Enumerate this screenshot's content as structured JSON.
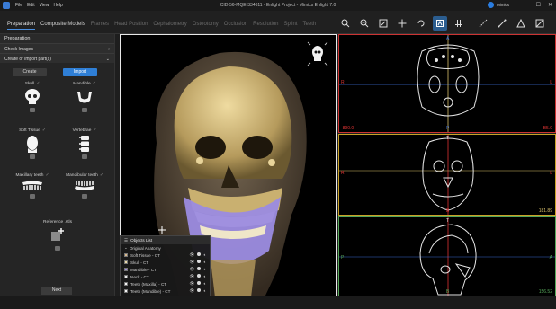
{
  "titlebar": {
    "menu": [
      "File",
      "Edit",
      "View",
      "Help"
    ],
    "title": "CID-56-MQE-334611 - Enlight Project - Mimics Enlight 7.0",
    "user": "Mimics",
    "controls": [
      "—",
      "☐",
      "✕"
    ]
  },
  "tabs": [
    "Preparation",
    "Composite Models",
    "Frames",
    "Head Position",
    "Cephalometry",
    "Osteotomy",
    "Occlusion",
    "Resolution",
    "Splint",
    "Teeth"
  ],
  "tools": [
    "zoom-in-icon",
    "zoom-fit-icon",
    "window-icon",
    "pan-icon",
    "rotate-icon",
    "view-3d-icon",
    "grid-icon",
    "measure-icon",
    "ruler-icon",
    "angle-icon",
    "frame-icon",
    "paint-icon"
  ],
  "panel": {
    "title": "Preparation",
    "check_images": "Check Images",
    "create_import": "Create or import part(s)",
    "create_label": "Create",
    "import_label": "Import",
    "parts": [
      {
        "label": "Skull",
        "check": "✓"
      },
      {
        "label": "Mandible",
        "check": "✓"
      },
      {
        "label": "Soft Tissue",
        "check": "✓"
      },
      {
        "label": "Vertebrae",
        "check": "✓"
      },
      {
        "label": "Maxillary teeth",
        "check": "✓"
      },
      {
        "label": "Mandibular teeth",
        "check": "✓"
      }
    ],
    "reference": "Reference .stls",
    "next_label": "Next"
  },
  "objects": {
    "title": "Objects List",
    "group": "Original Anatomy",
    "items": [
      {
        "name": "Soft Tissue - CT",
        "color": "#d9b98c"
      },
      {
        "name": "Skull - CT",
        "color": "#e9d8a6"
      },
      {
        "name": "Mandible - CT",
        "color": "#9b8be0"
      },
      {
        "name": "Neck - CT",
        "color": "#e8e8e8"
      },
      {
        "name": "Teeth (Maxilla) - CT",
        "color": "#f2f2f2"
      },
      {
        "name": "Teeth (Mandible) - CT",
        "color": "#f2f2f2"
      }
    ]
  },
  "viewports": {
    "top": {
      "left": "R",
      "right": "L",
      "top": "A",
      "bottom": "P",
      "value_left": "-890.0",
      "value_right": "B5.0"
    },
    "mid": {
      "left": "R",
      "right": "L",
      "top": "T",
      "bottom": "B",
      "value": "181.89"
    },
    "bot": {
      "left": "P",
      "right": "A",
      "top": "T",
      "bottom": "B",
      "value": "156.52"
    }
  }
}
